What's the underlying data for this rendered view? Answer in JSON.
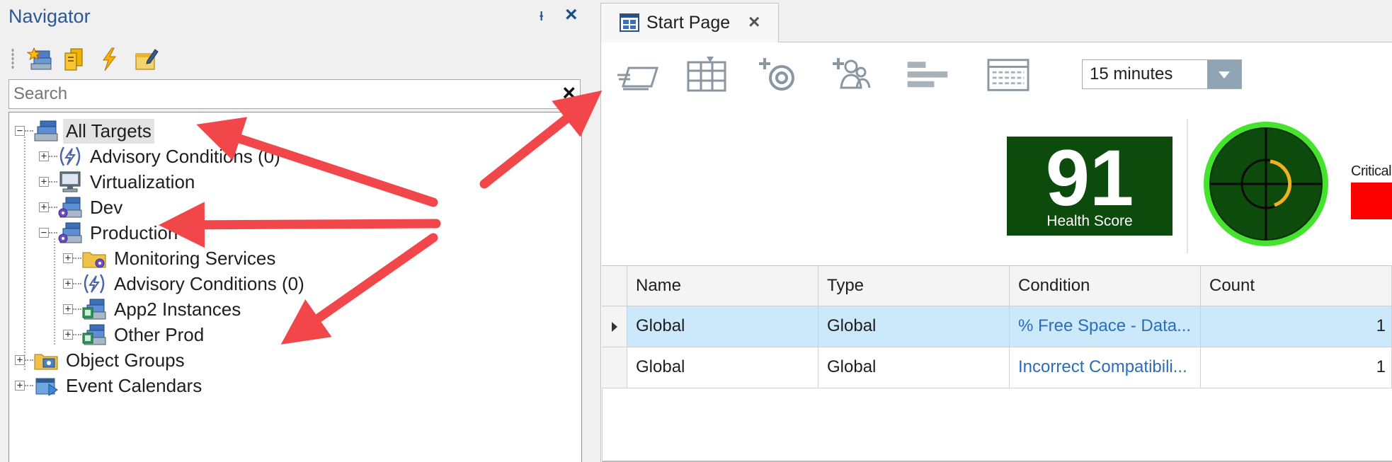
{
  "navigator": {
    "title": "Navigator",
    "search": {
      "placeholder": "Search"
    },
    "toolbar": [
      {
        "icon": "add-target-icon"
      },
      {
        "icon": "copy-icon"
      },
      {
        "icon": "lightning-icon"
      },
      {
        "icon": "edit-note-icon"
      }
    ],
    "tree": {
      "all_targets": "All Targets",
      "advisory_conditions": "Advisory Conditions (0)",
      "virtualization": "Virtualization",
      "dev": "Dev",
      "production": "Production",
      "monitoring_services": "Monitoring Services",
      "advisory_conditions_prod": "Advisory Conditions (0)",
      "app2_instances": "App2 Instances",
      "other_prod": "Other Prod",
      "object_groups": "Object Groups",
      "event_calendars": "Event Calendars"
    }
  },
  "tab": {
    "label": "Start Page"
  },
  "start_page": {
    "time_range": "15 minutes",
    "health": {
      "value": "91",
      "label": "Health Score"
    },
    "critical_label": "Critical",
    "colors": {
      "health_bg": "#0c4b0c",
      "critical": "#ff0000",
      "selection": "#cce8fb"
    }
  },
  "grid": {
    "columns": [
      "Name",
      "Type",
      "Condition",
      "Count"
    ],
    "rows": [
      {
        "name": "Global",
        "type": "Global",
        "condition": "% Free Space - Data...",
        "count": "1"
      },
      {
        "name": "Global",
        "type": "Global",
        "condition": "Incorrect Compatibili...",
        "count": "1"
      }
    ]
  }
}
